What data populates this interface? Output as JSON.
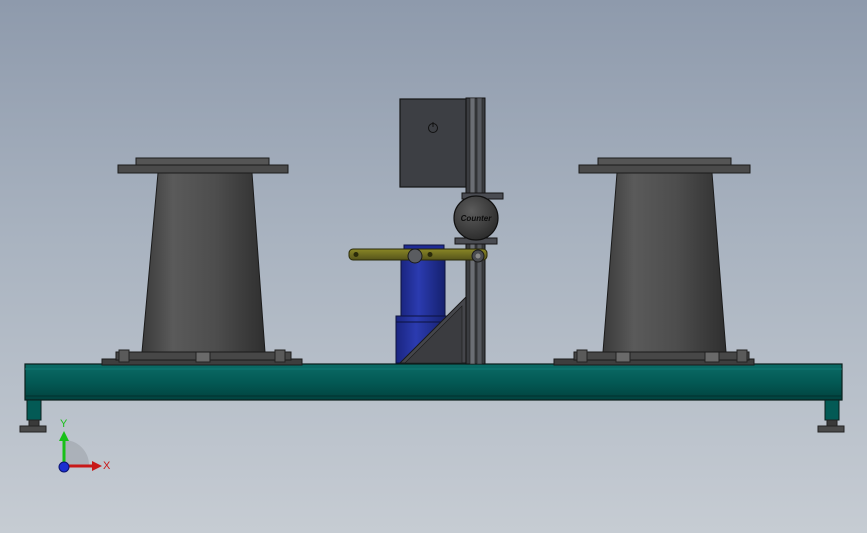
{
  "scene": {
    "counter_label": "Counter",
    "triad": {
      "y_label": "Y",
      "x_label": "X",
      "y_color": "#18c018",
      "x_color": "#c81818",
      "z_color": "#1a2fd0"
    },
    "colors": {
      "frame": "#035a55",
      "spool": "#4a4a4a",
      "enclosure": "#3d3f44",
      "arm": "#6c6a1a",
      "motor": "#1f2d99",
      "mast": "#2e3034"
    }
  }
}
